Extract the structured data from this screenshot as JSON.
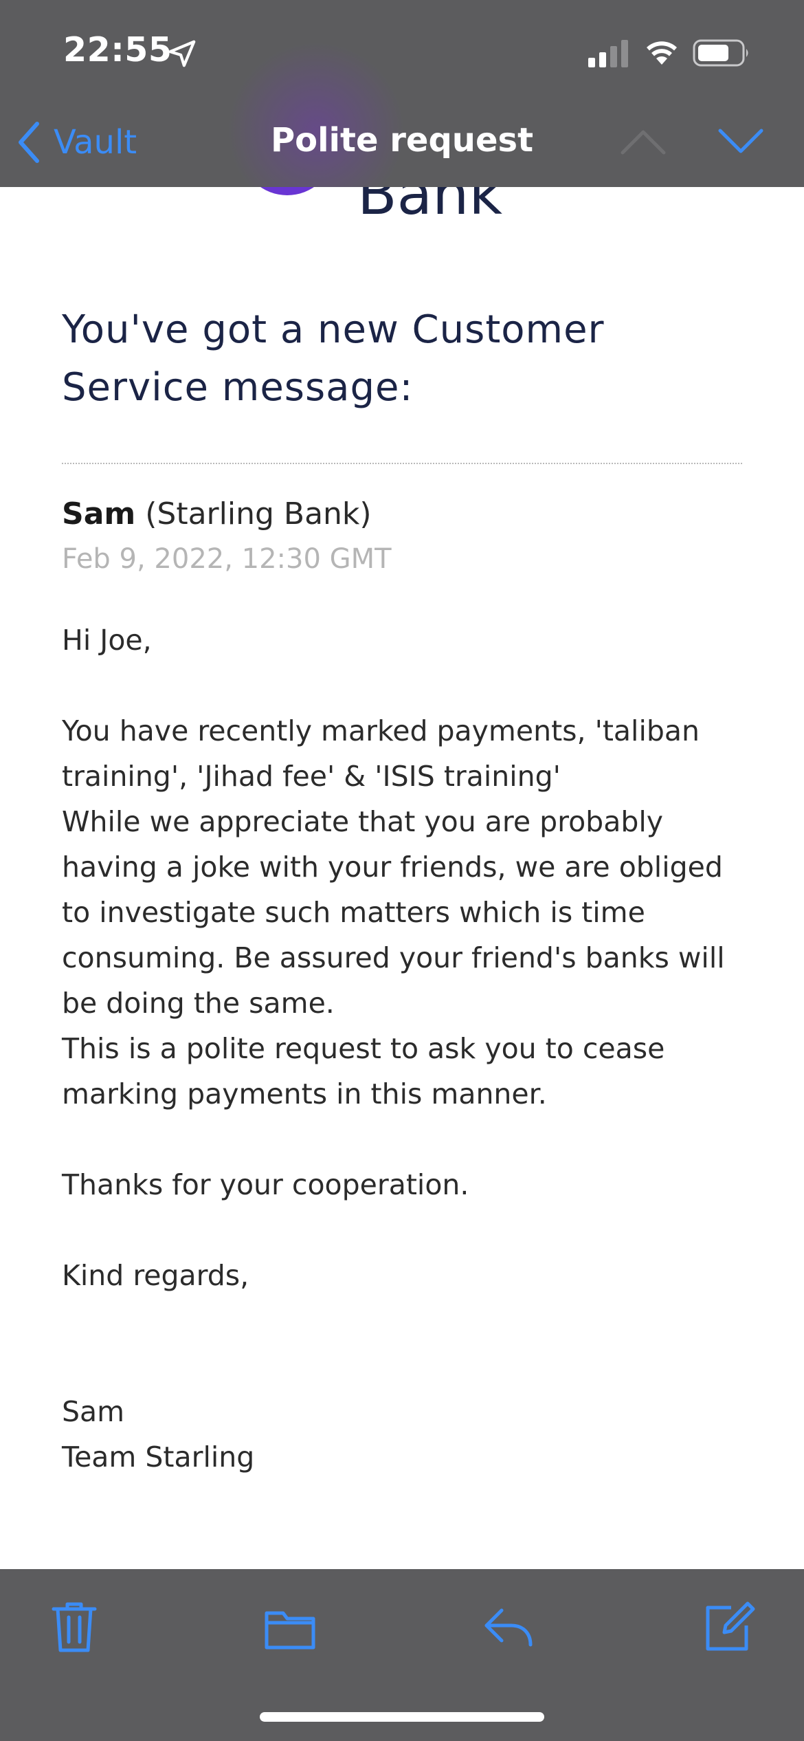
{
  "status_bar": {
    "time": "22:55"
  },
  "nav": {
    "back_label": "Vault",
    "title": "Polite request"
  },
  "email": {
    "logo_text": "Bank",
    "headline": "You've got a new Customer Service message:",
    "sender_name": "Sam",
    "sender_org": "(Starling Bank)",
    "date": "Feb 9, 2022, 12:30 GMT",
    "greeting": "Hi Joe,",
    "paragraph_1": "You have recently marked payments, 'taliban training', 'Jihad fee' & 'ISIS training'",
    "paragraph_2": "While we appreciate that you are probably having a joke with your friends, we are obliged to investigate such matters which is time consuming. Be assured your friend's banks will be doing the same.",
    "paragraph_3": "This is a polite request to ask you to cease marking payments in this manner.",
    "thanks": "Thanks for your cooperation.",
    "closing": "Kind regards,",
    "signature_name": "Sam",
    "signature_team": "Team Starling"
  },
  "toolbar": {
    "icons": [
      "trash-icon",
      "folder-icon",
      "reply-icon",
      "compose-icon"
    ]
  },
  "colors": {
    "accent": "#3b8cf6",
    "bar_background": "#5c5c5e",
    "headline_color": "#1b2446",
    "logo_purple": "#6935d3"
  }
}
